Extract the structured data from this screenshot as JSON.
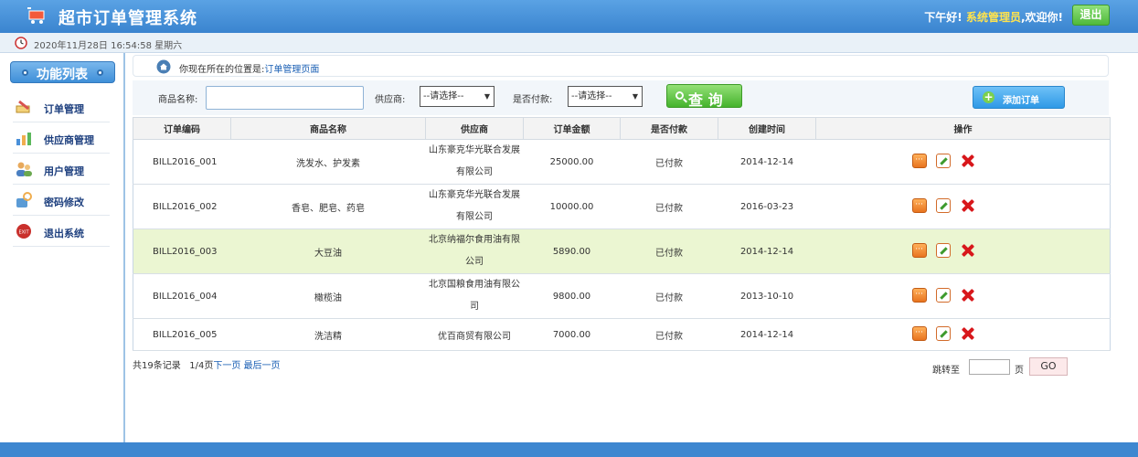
{
  "header": {
    "title": "超市订单管理系统",
    "greeting_prefix": "下午好!",
    "username": "系统管理员",
    "greeting_suffix": ",欢迎你!",
    "logout_label": "退出"
  },
  "timebar": {
    "datetime": "2020年11月28日 16:54:58 星期六"
  },
  "sidebar": {
    "title": "功能列表",
    "items": [
      {
        "label": "订单管理",
        "icon": "pen-notepad-icon"
      },
      {
        "label": "供应商管理",
        "icon": "chart-icon"
      },
      {
        "label": "用户管理",
        "icon": "users-icon"
      },
      {
        "label": "密码修改",
        "icon": "key-lock-icon"
      },
      {
        "label": "退出系统",
        "icon": "exit-icon"
      }
    ]
  },
  "breadcrumb": {
    "prefix": "你现在所在的位置是:",
    "current": "订单管理页面"
  },
  "search": {
    "product_label": "商品名称:",
    "product_value": "",
    "supplier_label": "供应商:",
    "supplier_selected": "--请选择--",
    "paid_label": "是否付款:",
    "paid_selected": "--请选择--",
    "query_label": "查 询",
    "add_label": "添加订单"
  },
  "table": {
    "headers": [
      "订单编码",
      "商品名称",
      "供应商",
      "订单金额",
      "是否付款",
      "创建时间",
      "操作"
    ],
    "rows": [
      {
        "code": "BILL2016_001",
        "product": "洗发水、护发素",
        "supplier": "山东豪克华光联合发展有限公司",
        "amount": "25000.00",
        "paid": "已付款",
        "created": "2014-12-14"
      },
      {
        "code": "BILL2016_002",
        "product": "香皂、肥皂、药皂",
        "supplier": "山东豪克华光联合发展有限公司",
        "amount": "10000.00",
        "paid": "已付款",
        "created": "2016-03-23"
      },
      {
        "code": "BILL2016_003",
        "product": "大豆油",
        "supplier": "北京纳福尔食用油有限公司",
        "amount": "5890.00",
        "paid": "已付款",
        "created": "2014-12-14"
      },
      {
        "code": "BILL2016_004",
        "product": "橄榄油",
        "supplier": "北京国粮食用油有限公司",
        "amount": "9800.00",
        "paid": "已付款",
        "created": "2013-10-10"
      },
      {
        "code": "BILL2016_005",
        "product": "洗洁精",
        "supplier": "优百商贸有限公司",
        "amount": "7000.00",
        "paid": "已付款",
        "created": "2014-12-14"
      }
    ]
  },
  "pager": {
    "total": "共19条记录",
    "page": "1/4页",
    "next": "下一页",
    "last": "最后一页",
    "jump_label": "跳转至",
    "jump_value": "",
    "jump_unit": "页",
    "go_label": "GO"
  }
}
